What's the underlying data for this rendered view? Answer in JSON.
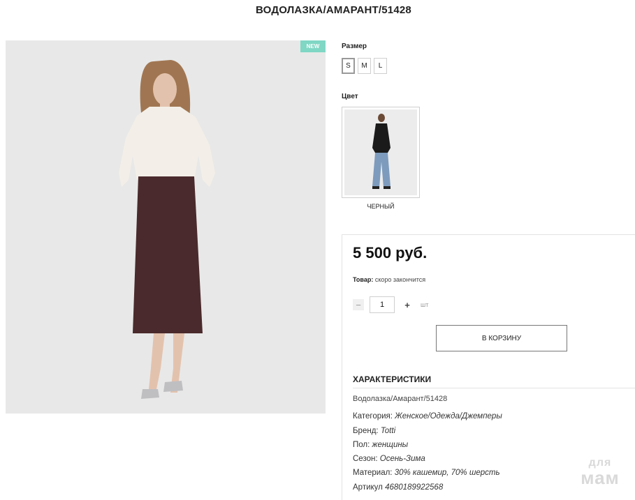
{
  "product": {
    "title": "ВОДОЛАЗКА/АМАРАНТ/51428",
    "badge": "NEW"
  },
  "options": {
    "size_label": "Размер",
    "sizes": [
      "S",
      "M",
      "L"
    ],
    "selected_size": "S",
    "color_label": "Цвет",
    "color_name": "ЧЕРНЫЙ"
  },
  "purchase": {
    "price": "5 500 руб.",
    "stock_label": "Товар:",
    "stock_value": "скоро закончится",
    "qty_minus": "−",
    "qty_value": "1",
    "qty_plus": "+",
    "qty_unit": "шт",
    "cart_button": "В КОРЗИНУ"
  },
  "specs": {
    "title": "ХАРАКТЕРИСТИКИ",
    "subtitle": "Водолазка/Амарант/51428",
    "rows": [
      {
        "label": "Категория:",
        "value": "Женское/Одежда/Джемперы"
      },
      {
        "label": "Бренд:",
        "value": "Totti"
      },
      {
        "label": "Пол:",
        "value": "женщины"
      },
      {
        "label": "Сезон:",
        "value": "Осень-Зима"
      },
      {
        "label": "Материал:",
        "value": "30% кашемир, 70% шерсть"
      },
      {
        "label": "Артикул",
        "value": "4680189922568"
      }
    ]
  },
  "watermark": {
    "line1": "для",
    "line2": "мам"
  },
  "colors": {
    "badge": "#7fd7c4",
    "skirt": "#4a2a2c",
    "sweater": "#f2efe9"
  }
}
